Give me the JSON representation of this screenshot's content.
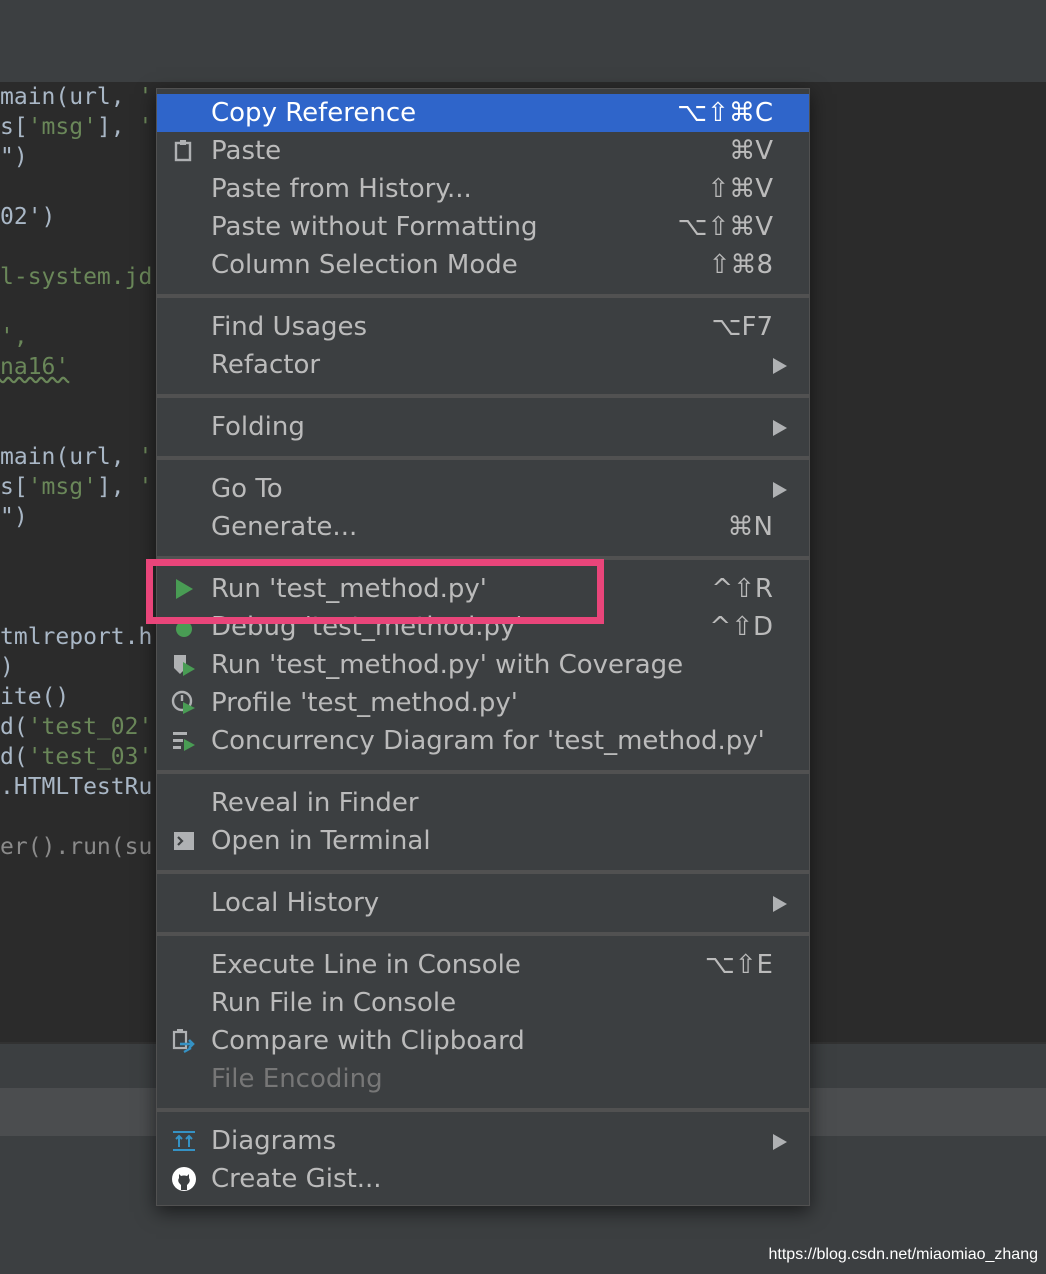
{
  "editor": {
    "code_lines": [
      {
        "t": "main(url, ",
        "s": "'"
      },
      {
        "t": "s[",
        "s": "'msg'",
        "u": "], ",
        "s2": "'"
      },
      {
        "t": "\")",
        "s": ""
      },
      {
        "t": "",
        "s": ""
      },
      {
        "t": "02')",
        "s": ""
      },
      {
        "t": "",
        "s": ""
      },
      {
        "t": "",
        "s": "l-system.jd"
      },
      {
        "t": "",
        "s": ""
      },
      {
        "t": "",
        "s": "',"
      },
      {
        "t": "",
        "s": "na16'"
      },
      {
        "t": "",
        "s": ""
      },
      {
        "t": "",
        "s": ""
      },
      {
        "t": "main(url, ",
        "s": "'"
      },
      {
        "t": "s[",
        "s": "'msg'",
        "u": "], ",
        "s2": "'"
      },
      {
        "t": "\")",
        "s": ""
      },
      {
        "t": "",
        "s": ""
      },
      {
        "t": "",
        "s": ""
      },
      {
        "t": "tmlreport.h",
        "s": ""
      },
      {
        "t": ")",
        "s": ""
      },
      {
        "t": "ite()",
        "s": ""
      },
      {
        "t": "d(",
        "s": "'test_02'"
      },
      {
        "t": "d(",
        "s": "'test_03'"
      },
      {
        "t": ".HTMLTestRu",
        "s": ""
      },
      {
        "t": "",
        "s": ""
      },
      {
        "t": "er().run(su",
        "s": ""
      }
    ]
  },
  "context_menu": {
    "items": [
      {
        "label": "Copy Reference",
        "shortcut": "⌥⇧⌘C",
        "icon": "",
        "selected": true
      },
      {
        "label": "Paste",
        "shortcut": "⌘V",
        "icon": "clipboard-icon"
      },
      {
        "label": "Paste from History...",
        "shortcut": "⇧⌘V"
      },
      {
        "label": "Paste without Formatting",
        "shortcut": "⌥⇧⌘V"
      },
      {
        "label": "Column Selection Mode",
        "shortcut": "⇧⌘8"
      },
      {
        "label": "Find Usages",
        "shortcut": "⌥F7"
      },
      {
        "label": "Refactor",
        "submenu": true
      },
      {
        "label": "Folding",
        "submenu": true
      },
      {
        "label": "Go To",
        "submenu": true
      },
      {
        "label": "Generate...",
        "shortcut": "⌘N"
      },
      {
        "label": "Run 'test_method.py'",
        "shortcut": "^⇧R",
        "icon": "run-icon"
      },
      {
        "label": "Debug 'test_method.py'",
        "shortcut": "^⇧D",
        "icon": "debug-icon"
      },
      {
        "label": "Run 'test_method.py' with Coverage",
        "icon": "coverage-icon"
      },
      {
        "label": "Profile 'test_method.py'",
        "icon": "profile-icon"
      },
      {
        "label": "Concurrency Diagram for 'test_method.py'",
        "icon": "concurrency-icon"
      },
      {
        "label": "Reveal in Finder"
      },
      {
        "label": "Open in Terminal",
        "icon": "terminal-icon"
      },
      {
        "label": "Local History",
        "submenu": true
      },
      {
        "label": "Execute Line in Console",
        "shortcut": "⌥⇧E"
      },
      {
        "label": "Run File in Console"
      },
      {
        "label": "Compare with Clipboard",
        "icon": "compare-icon"
      },
      {
        "label": "File Encoding",
        "disabled": true
      },
      {
        "label": "Diagrams",
        "submenu": true,
        "icon": "diagrams-icon"
      },
      {
        "label": "Create Gist...",
        "icon": "github-icon"
      }
    ]
  },
  "watermark": "https://blog.csdn.net/miaomiao_zhang",
  "colors": {
    "selection": "#2f65ca",
    "highlight_box": "#e9457a",
    "run_green": "#499c54",
    "menu_bg": "#3c3f41"
  }
}
